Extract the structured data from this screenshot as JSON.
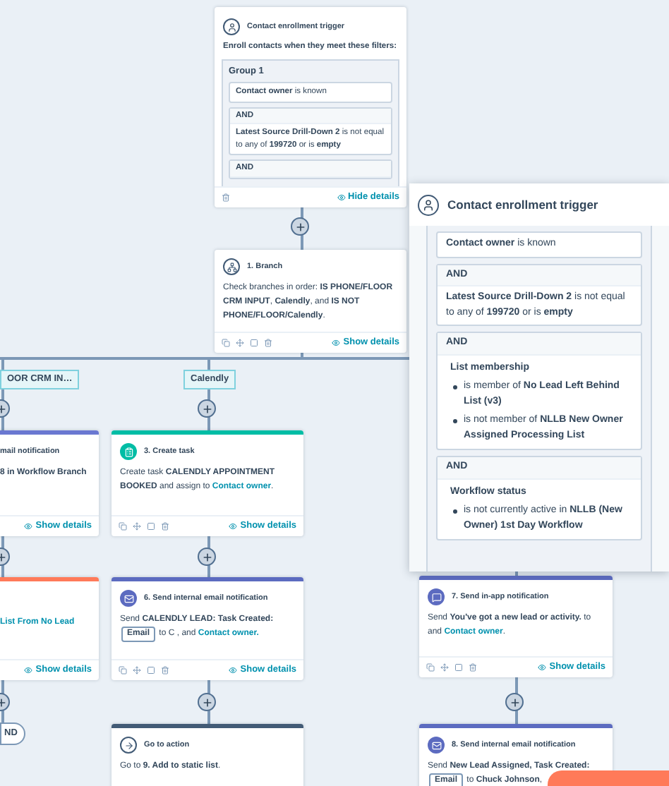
{
  "trigger": {
    "title": "Contact enrollment trigger",
    "intro": "Enroll contacts when they meet these filters:",
    "group_title": "Group 1",
    "filters": [
      {
        "text": "**Contact owner** is known"
      },
      {
        "connector": "AND",
        "text": "**Latest Source Drill-Down 2** is not equal to any of **199720** or is **empty**"
      },
      {
        "connector": "AND"
      }
    ],
    "toggle": "Hide details"
  },
  "nodes": [
    {
      "kind": "branch",
      "title": "1. Branch",
      "segments": [
        {
          "kind": "text",
          "text": "Check branches in order: **IS PHONE/FLOOR CRM INPUT**, **Calendly**, and **IS NOT PHONE/FLOOR/Calendly**."
        }
      ],
      "footer": "Show details"
    },
    {
      "kind": "cut",
      "title": "mail notification",
      "color": "#6a78d1",
      "segments": [
        {
          "kind": "strong",
          "text": "8 in Workflow Branch"
        }
      ],
      "footer": "Show details"
    },
    {
      "kind": "task",
      "title": "3. Create task",
      "color": "#00bda5",
      "segments": [
        {
          "kind": "text",
          "text": "Create task **CALENDLY APPOINTMENT BOOKED** and assign to "
        },
        {
          "kind": "link",
          "text": "Contact owner"
        },
        {
          "kind": "text",
          "text": "."
        }
      ],
      "footer": "Show details"
    },
    {
      "kind": "cut",
      "color": "#ff7a59",
      "segments": [
        {
          "kind": "link",
          "text": "List From No Lead"
        }
      ],
      "footer": "Show details"
    },
    {
      "kind": "email",
      "title": "6. Send internal email notification",
      "color": "#5c6bc0",
      "segments": [
        {
          "kind": "text",
          "text": "Send **CALENDLY LEAD: Task Created:** "
        },
        {
          "kind": "tag",
          "text": "Email"
        },
        {
          "kind": "text",
          "text": " to C"
        },
        {
          "kind": "text",
          "text": " , and "
        },
        {
          "kind": "link",
          "text": "Contact owner."
        }
      ],
      "footer": "Show details"
    },
    {
      "kind": "goto",
      "title": "Go to action",
      "color": "#425b76",
      "segments": [
        {
          "kind": "text",
          "text": "Go to **9. Add to static list**."
        }
      ]
    },
    {
      "kind": "inapp",
      "title": "7. Send in-app notification",
      "color": "#5c6bc0",
      "segments": [
        {
          "kind": "text",
          "text": "Send **You've got a new lead or activity.** to"
        },
        {
          "kind": "text",
          "text": " and "
        },
        {
          "kind": "link",
          "text": "Contact owner"
        },
        {
          "kind": "text",
          "text": "."
        }
      ],
      "footer": "Show details"
    },
    {
      "kind": "email",
      "title": "8. Send internal email notification",
      "color": "#5c6bc0",
      "segments": [
        {
          "kind": "text",
          "text": "Send **New Lead Assigned, Task Created:** "
        },
        {
          "kind": "tag",
          "text": "Email"
        },
        {
          "kind": "text",
          "text": " to **Chuck Johnson**,"
        }
      ]
    }
  ],
  "branch_labels": [
    "OOR CRM IN…",
    "Calendly"
  ],
  "end_label": "ND",
  "popup": {
    "title": "Contact enrollment trigger",
    "filters": [
      {
        "text": "**Contact owner** is known"
      },
      {
        "connector": "AND",
        "text": "**Latest Source Drill-Down 2** is not equal to any of **199720** or is **empty**"
      },
      {
        "connector": "AND",
        "heading": "List membership",
        "bullets": [
          "is member of **No Lead Left Behind List (v3)**",
          "is not member of **NLLB New Owner Assigned Processing List**"
        ]
      },
      {
        "connector": "AND",
        "heading": "Workflow status",
        "bullets": [
          "is not currently active in **NLLB (New Owner) 1st Day Workflow**"
        ]
      }
    ]
  }
}
